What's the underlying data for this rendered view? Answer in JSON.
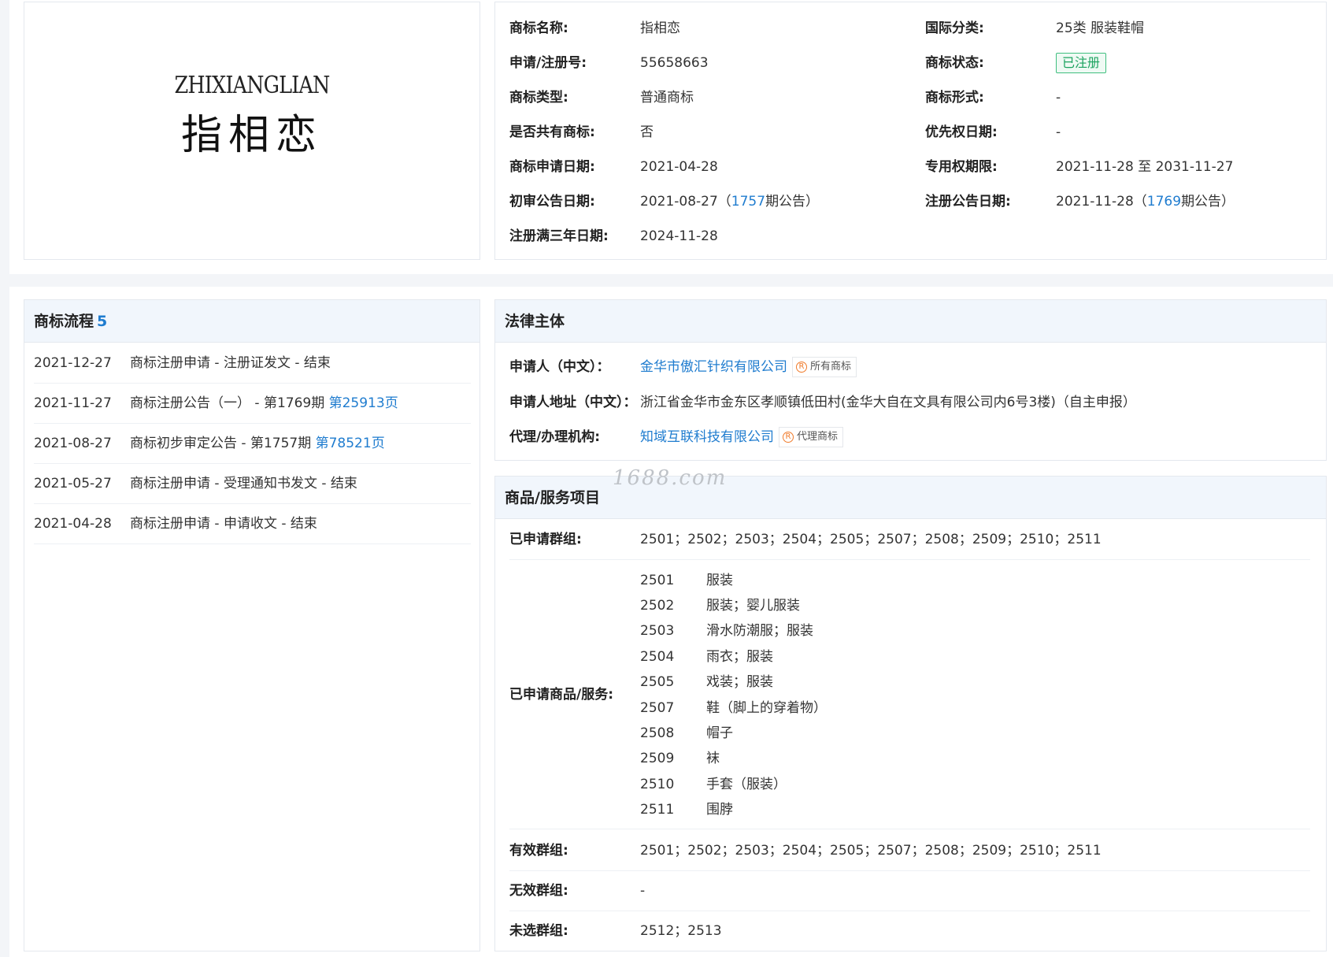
{
  "logo": {
    "en": "ZHIXIANGLIAN",
    "cn": "指相恋"
  },
  "info": {
    "name_label": "商标名称:",
    "name_value": "指相恋",
    "class_label": "国际分类:",
    "class_value": "25类 服装鞋帽",
    "regno_label": "申请/注册号:",
    "regno_value": "55658663",
    "status_label": "商标状态:",
    "status_value": "已注册",
    "type_label": "商标类型:",
    "type_value": "普通商标",
    "form_label": "商标形式:",
    "form_value": "-",
    "shared_label": "是否共有商标:",
    "shared_value": "否",
    "priority_label": "优先权日期:",
    "priority_value": "-",
    "apply_date_label": "商标申请日期:",
    "apply_date_value": "2021-04-28",
    "exclusive_label": "专用权期限:",
    "exclusive_value": "2021-11-28 至 2031-11-27",
    "prelim_label": "初审公告日期:",
    "prelim_date": "2021-08-27（",
    "prelim_issue": "1757",
    "prelim_suffix": "期公告）",
    "regpub_label": "注册公告日期:",
    "regpub_date": "2021-11-28（",
    "regpub_issue": "1769",
    "regpub_suffix": "期公告）",
    "three_year_label": "注册满三年日期:",
    "three_year_value": "2024-11-28"
  },
  "flow": {
    "title": "商标流程",
    "count": "5",
    "items": [
      {
        "date": "2021-12-27",
        "text": "商标注册申请 - 注册证发文 - 结束",
        "link": ""
      },
      {
        "date": "2021-11-27",
        "text": "商标注册公告（一） - 第1769期 ",
        "link": "第25913页"
      },
      {
        "date": "2021-08-27",
        "text": "商标初步审定公告 - 第1757期 ",
        "link": "第78521页"
      },
      {
        "date": "2021-05-27",
        "text": "商标注册申请 - 受理通知书发文 - 结束",
        "link": ""
      },
      {
        "date": "2021-04-28",
        "text": "商标注册申请 - 申请收文 - 结束",
        "link": ""
      }
    ]
  },
  "legal": {
    "title": "法律主体",
    "applicant_label": "申请人（中文）：",
    "applicant_value": "金华市傲汇针织有限公司",
    "applicant_badge": "所有商标",
    "address_label": "申请人地址（中文）：",
    "address_value": "浙江省金华市金东区孝顺镇低田村(金华大自在文具有限公司内6号3楼)（自主申报）",
    "agent_label": "代理/办理机构:",
    "agent_value": "知域互联科技有限公司",
    "agent_badge": "代理商标",
    "badge_mark": "R"
  },
  "goods": {
    "title": "商品/服务项目",
    "groups_label": "已申请群组:",
    "groups_value": "2501；2502；2503；2504；2505；2507；2508；2509；2510；2511",
    "items_label": "已申请商品/服务:",
    "items": [
      {
        "code": "2501",
        "name": "服装"
      },
      {
        "code": "2502",
        "name": "服装；婴儿服装"
      },
      {
        "code": "2503",
        "name": "滑水防潮服；服装"
      },
      {
        "code": "2504",
        "name": "雨衣；服装"
      },
      {
        "code": "2505",
        "name": "戏装；服装"
      },
      {
        "code": "2507",
        "name": "鞋（脚上的穿着物）"
      },
      {
        "code": "2508",
        "name": "帽子"
      },
      {
        "code": "2509",
        "name": "袜"
      },
      {
        "code": "2510",
        "name": "手套（服装）"
      },
      {
        "code": "2511",
        "name": "围脖"
      }
    ],
    "valid_label": "有效群组:",
    "valid_value": "2501；2502；2503；2504；2505；2507；2508；2509；2510；2511",
    "invalid_label": "无效群组:",
    "invalid_value": "-",
    "unselected_label": "未选群组:",
    "unselected_value": "2512；2513"
  },
  "watermark": "1688.com"
}
